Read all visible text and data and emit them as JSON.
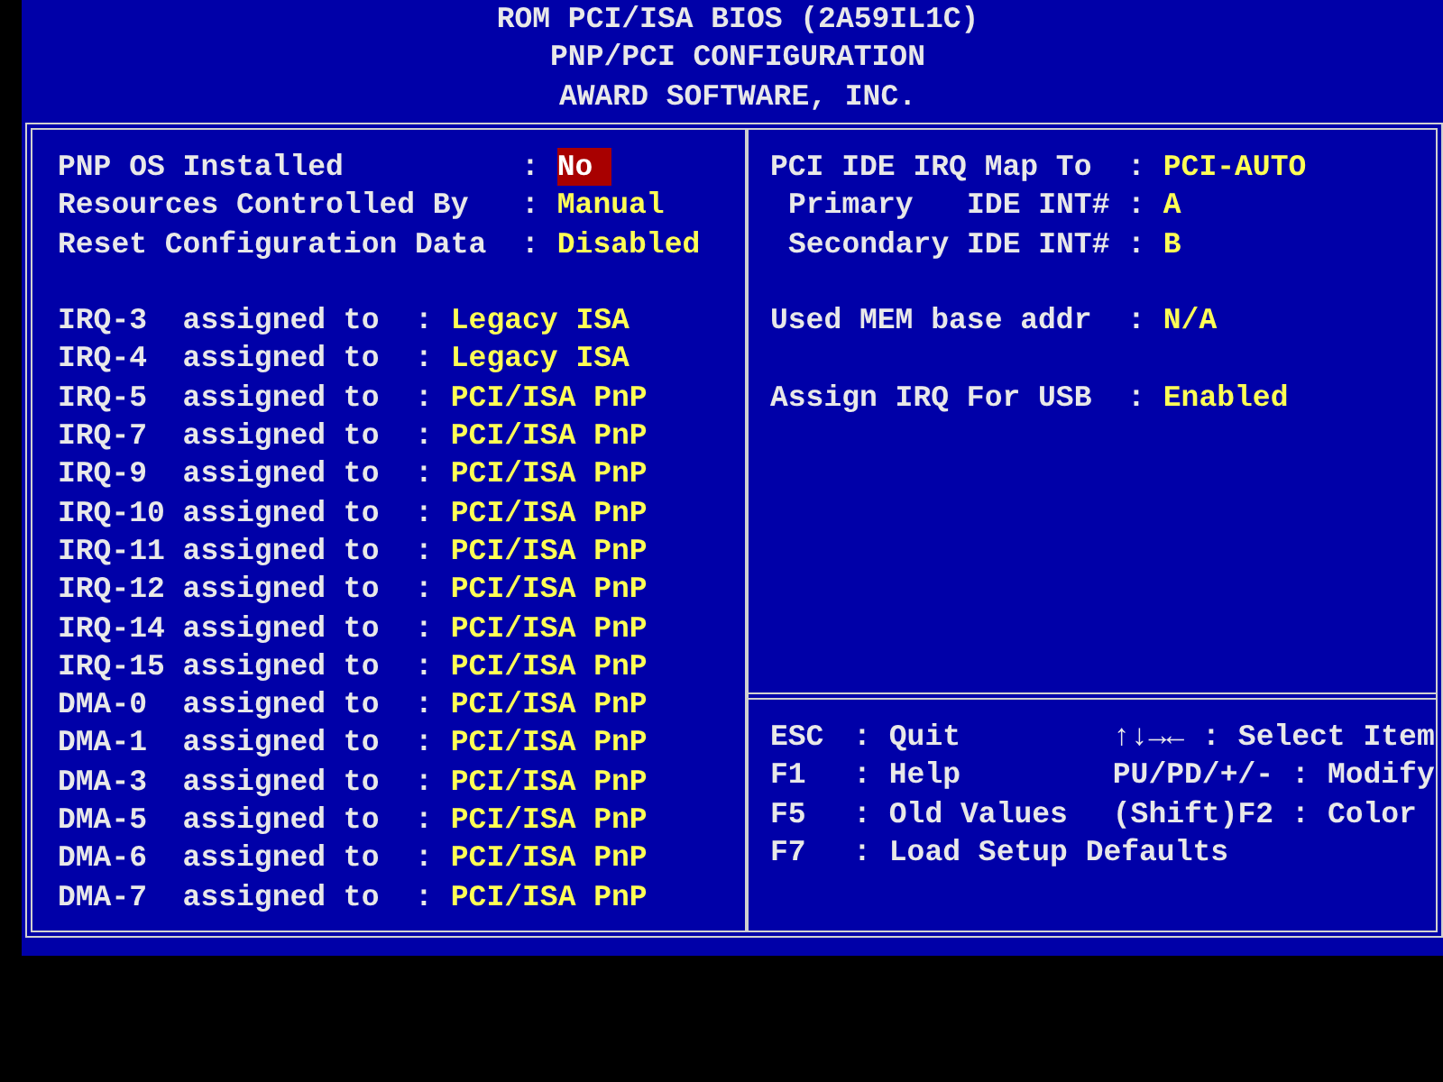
{
  "header": {
    "lines": [
      "ROM PCI/ISA BIOS (2A59IL1C)",
      "PNP/PCI CONFIGURATION",
      "AWARD SOFTWARE, INC."
    ]
  },
  "left_panel": {
    "groups": [
      {
        "kind": "setting",
        "items": [
          {
            "label": "PNP OS Installed",
            "separator": ":",
            "value": "No",
            "selected": true
          },
          {
            "label": "Resources Controlled By",
            "separator": ":",
            "value": "Manual",
            "selected": false
          },
          {
            "label": "Reset Configuration Data",
            "separator": ":",
            "value": "Disabled",
            "selected": false
          }
        ]
      },
      {
        "kind": "assign",
        "items": [
          {
            "label": "IRQ-3  assigned to",
            "separator": ":",
            "value": "Legacy ISA",
            "selected": false
          },
          {
            "label": "IRQ-4  assigned to",
            "separator": ":",
            "value": "Legacy ISA",
            "selected": false
          },
          {
            "label": "IRQ-5  assigned to",
            "separator": ":",
            "value": "PCI/ISA PnP",
            "selected": false
          },
          {
            "label": "IRQ-7  assigned to",
            "separator": ":",
            "value": "PCI/ISA PnP",
            "selected": false
          },
          {
            "label": "IRQ-9  assigned to",
            "separator": ":",
            "value": "PCI/ISA PnP",
            "selected": false
          },
          {
            "label": "IRQ-10 assigned to",
            "separator": ":",
            "value": "PCI/ISA PnP",
            "selected": false
          },
          {
            "label": "IRQ-11 assigned to",
            "separator": ":",
            "value": "PCI/ISA PnP",
            "selected": false
          },
          {
            "label": "IRQ-12 assigned to",
            "separator": ":",
            "value": "PCI/ISA PnP",
            "selected": false
          },
          {
            "label": "IRQ-14 assigned to",
            "separator": ":",
            "value": "PCI/ISA PnP",
            "selected": false
          },
          {
            "label": "IRQ-15 assigned to",
            "separator": ":",
            "value": "PCI/ISA PnP",
            "selected": false
          },
          {
            "label": "DMA-0  assigned to",
            "separator": ":",
            "value": "PCI/ISA PnP",
            "selected": false
          },
          {
            "label": "DMA-1  assigned to",
            "separator": ":",
            "value": "PCI/ISA PnP",
            "selected": false
          },
          {
            "label": "DMA-3  assigned to",
            "separator": ":",
            "value": "PCI/ISA PnP",
            "selected": false
          },
          {
            "label": "DMA-5  assigned to",
            "separator": ":",
            "value": "PCI/ISA PnP",
            "selected": false
          },
          {
            "label": "DMA-6  assigned to",
            "separator": ":",
            "value": "PCI/ISA PnP",
            "selected": false
          },
          {
            "label": "DMA-7  assigned to",
            "separator": ":",
            "value": "PCI/ISA PnP",
            "selected": false
          }
        ]
      }
    ]
  },
  "right_panel": {
    "groups": [
      {
        "items": [
          {
            "kind": "main",
            "label": "PCI IDE IRQ Map To",
            "separator": ":",
            "value": "PCI-AUTO",
            "selected": false
          },
          {
            "kind": "sub",
            "label": "Primary   IDE INT#",
            "separator": ":",
            "value": "A",
            "selected": false
          },
          {
            "kind": "sub",
            "label": "Secondary IDE INT#",
            "separator": ":",
            "value": "B",
            "selected": false
          }
        ]
      },
      {
        "items": [
          {
            "kind": "main",
            "label": "Used MEM base addr",
            "separator": ":",
            "value": "N/A",
            "selected": false
          }
        ]
      },
      {
        "items": [
          {
            "kind": "main",
            "label": "Assign IRQ For USB",
            "separator": ":",
            "value": "Enabled",
            "selected": false
          }
        ]
      }
    ]
  },
  "help": {
    "rows": [
      {
        "key": "ESC",
        "separator": ":",
        "action": "Quit",
        "key_2": "↑↓→←",
        "separator_2": ":",
        "action_2": "Select Item"
      },
      {
        "key": "F1",
        "separator": ":",
        "action": "Help",
        "key_2": "PU/PD/+/-",
        "separator_2": ":",
        "action_2": "Modify"
      },
      {
        "key": "F5",
        "separator": ":",
        "action": "Old Values",
        "key_2": "(Shift)F2",
        "separator_2": ":",
        "action_2": "Color"
      },
      {
        "key": "F7",
        "separator": ":",
        "action": "Load Setup Defaults"
      }
    ]
  }
}
